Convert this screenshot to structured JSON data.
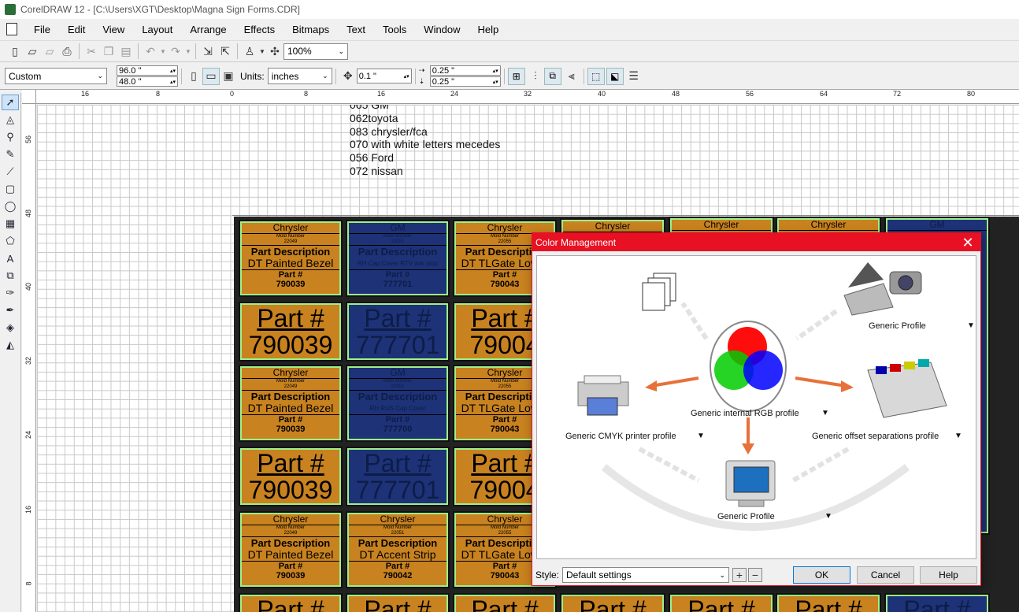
{
  "window": {
    "title": "CorelDRAW 12 - [C:\\Users\\XGT\\Desktop\\Magna Sign Forms.CDR]"
  },
  "menu": [
    {
      "label": "File"
    },
    {
      "label": "Edit"
    },
    {
      "label": "View"
    },
    {
      "label": "Layout"
    },
    {
      "label": "Arrange"
    },
    {
      "label": "Effects"
    },
    {
      "label": "Bitmaps"
    },
    {
      "label": "Text"
    },
    {
      "label": "Tools"
    },
    {
      "label": "Window"
    },
    {
      "label": "Help"
    }
  ],
  "toolbar": {
    "zoom": "100%"
  },
  "propertybar": {
    "page_size": "Custom",
    "width": "96.0 \"",
    "height": "48.0 \"",
    "units_label": "Units:",
    "units": "inches",
    "nudge": "0.1 \"",
    "dup_x": "0.25 \"",
    "dup_y": "0.25 \""
  },
  "ruler": {
    "h_ticks": [
      "16",
      "8",
      "0",
      "8",
      "16",
      "24",
      "32",
      "40",
      "48",
      "56",
      "64",
      "72",
      "80"
    ],
    "v_ticks": [
      "56",
      "48",
      "40",
      "32",
      "24",
      "16",
      "8"
    ]
  },
  "notes": [
    "065 GM",
    "062toyota",
    "083 chrysler/fca",
    "070 with white letters mecedes",
    "056 Ford",
    "072 nissan"
  ],
  "tiles": {
    "row1": [
      {
        "make": "Chrysler",
        "mold_label": "Mold Number",
        "mold": "22049",
        "pd": "Part Description",
        "desc": "DT Painted Bezel",
        "pn": "Part #",
        "pv": "790039",
        "color": "o"
      },
      {
        "make": "GM",
        "mold_label": "Mold Number",
        "mold": "22051",
        "pd": "Part Description",
        "desc": "RH Cap Cover RTV wrk stop",
        "pn": "Part #",
        "pv": "777701",
        "color": "b"
      },
      {
        "make": "Chrysler",
        "mold_label": "Mold Number",
        "mold": "22055",
        "pd": "Part Description",
        "desc": "DT TLGate Lower",
        "pn": "Part #",
        "pv": "790043",
        "color": "o"
      }
    ],
    "row2": [
      {
        "make": "Chrysler",
        "mold_label": "Mold Number",
        "mold": "22049",
        "pd": "Part Description",
        "desc": "DT Painted Bezel",
        "pn": "Part #",
        "pv": "790039",
        "color": "o"
      },
      {
        "make": "GM",
        "mold_label": "Mold Number",
        "mold": "22051",
        "pd": "Part Description",
        "desc": "RH RUS Cap Cover",
        "pn": "Part #",
        "pv": "777700",
        "color": "b"
      },
      {
        "make": "Chrysler",
        "mold_label": "Mold Number",
        "mold": "22055",
        "pd": "Part Description",
        "desc": "DT TLGate Lower",
        "pn": "Part #",
        "pv": "790043",
        "color": "o"
      }
    ],
    "row3": [
      {
        "make": "Chrysler",
        "mold_label": "Mold Number",
        "mold": "22049",
        "pd": "Part Description",
        "desc": "DT Painted Bezel",
        "pn": "Part #",
        "pv": "790039",
        "color": "o"
      },
      {
        "make": "Chrysler",
        "mold_label": "Mold Number",
        "mold": "22051",
        "pd": "Part Description",
        "desc": "DT Accent Strip",
        "pn": "Part #",
        "pv": "790042",
        "color": "o"
      },
      {
        "make": "Chrysler",
        "mold_label": "Mold Number",
        "mold": "22055",
        "pd": "Part Description",
        "desc": "DT TLGate Lower",
        "pn": "Part #",
        "pv": "790043",
        "color": "o"
      }
    ],
    "big1": [
      {
        "t1": "Part #",
        "t2": "790039",
        "color": "o"
      },
      {
        "t1": "Part #",
        "t2": "777701",
        "color": "b"
      },
      {
        "t1": "Part #",
        "t2": "79004",
        "color": "o"
      }
    ],
    "big2": [
      {
        "t1": "Part #",
        "t2": "790039",
        "color": "o"
      },
      {
        "t1": "Part #",
        "t2": "777701",
        "color": "b"
      },
      {
        "t1": "Part #",
        "t2": "79004",
        "color": "o"
      }
    ],
    "top_right_makes": [
      "Chrysler",
      "Chrysler",
      "Chrysler",
      "GM"
    ],
    "bottom_partial": [
      "Part #",
      "Part #",
      "Part #",
      "Part #",
      "Part #",
      "Part #",
      "Part #"
    ]
  },
  "dialog": {
    "title": "Color Management",
    "profiles": {
      "input": "Generic Profile",
      "internal": "Generic internal RGB profile",
      "printer": "Generic CMYK printer profile",
      "separations": "Generic offset separations profile",
      "monitor": "Generic Profile"
    },
    "style_label": "Style:",
    "style_value": "Default settings",
    "ok": "OK",
    "cancel": "Cancel",
    "help": "Help"
  },
  "colors": {
    "orange": "#c8821f",
    "navy": "#1e3278",
    "dialog_accent": "#e81123"
  }
}
